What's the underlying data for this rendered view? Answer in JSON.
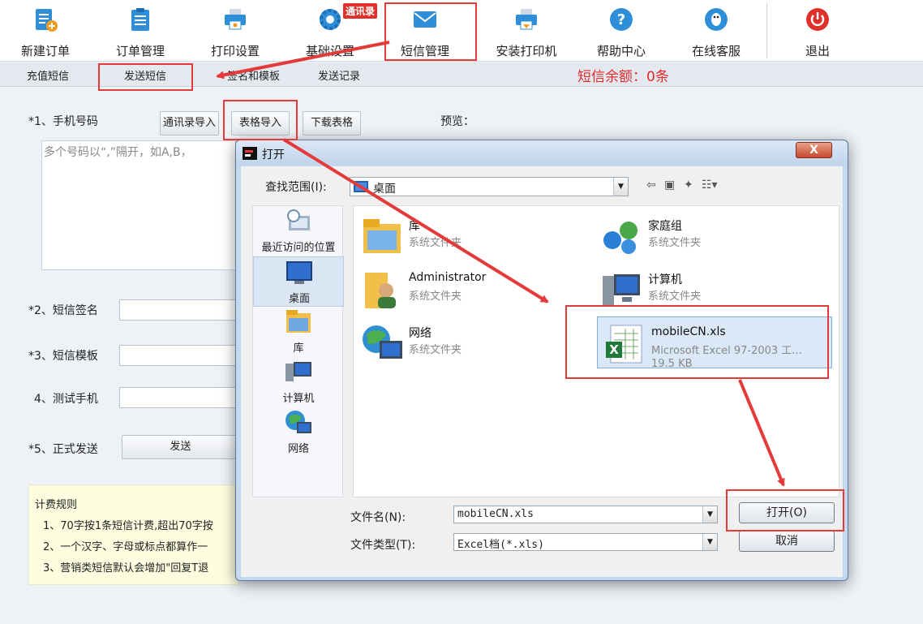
{
  "toolbar": {
    "items": [
      {
        "label": "新建订单",
        "icon": "new-order-icon"
      },
      {
        "label": "订单管理",
        "icon": "clipboard-icon"
      },
      {
        "label": "打印设置",
        "icon": "printer-settings-icon"
      },
      {
        "label": "基础设置",
        "icon": "gear-icon"
      },
      {
        "label": "短信管理",
        "icon": "envelope-icon"
      },
      {
        "label": "安装打印机",
        "icon": "install-printer-icon"
      },
      {
        "label": "帮助中心",
        "icon": "help-icon"
      },
      {
        "label": "在线客服",
        "icon": "customer-service-icon"
      },
      {
        "label": "退出",
        "icon": "power-icon"
      }
    ],
    "badge": "通讯录"
  },
  "tabs": [
    "充值短信",
    "发送短信",
    "签名和模板",
    "发送记录"
  ],
  "balance": "短信余额：0条",
  "form": {
    "phone_label": "*1、手机号码",
    "btn_contacts": "通讯录导入",
    "btn_table": "表格导入",
    "btn_download": "下载表格",
    "preview_label": "预览：",
    "phone_placeholder": "多个号码以“,”隔开，如A,B，",
    "signature_label": "*2、短信签名",
    "template_label": "*3、短信模板",
    "test_label": "4、测试手机",
    "send_label": "*5、正式发送",
    "send_button": "发送"
  },
  "rules": {
    "title": "计费规则",
    "lines": [
      "1、70字按1条短信计费,超出70字按",
      "2、一个汉字、字母或标点都算作一",
      "3、营销类短信默认会增加\"回复T退"
    ]
  },
  "dialog": {
    "title": "打开",
    "close": "X",
    "look_in_label": "查找范围(I):",
    "look_in_value": "桌面",
    "places": [
      {
        "label": "最近访问的位置",
        "icon": "recent-places-icon"
      },
      {
        "label": "桌面",
        "icon": "desktop-icon"
      },
      {
        "label": "库",
        "icon": "library-icon"
      },
      {
        "label": "计算机",
        "icon": "computer-icon"
      },
      {
        "label": "网络",
        "icon": "network-icon"
      }
    ],
    "files": [
      {
        "name": "库",
        "desc": "系统文件夹",
        "icon": "library-folder-icon"
      },
      {
        "name": "家庭组",
        "desc": "系统文件夹",
        "icon": "homegroup-icon"
      },
      {
        "name": "Administrator",
        "desc": "系统文件夹",
        "icon": "user-folder-icon"
      },
      {
        "name": "计算机",
        "desc": "系统文件夹",
        "icon": "computer-icon"
      },
      {
        "name": "网络",
        "desc": "系统文件夹",
        "icon": "network-icon"
      },
      {
        "name": "mobileCN.xls",
        "desc": "Microsoft Excel 97-2003 工...",
        "size": "19.5 KB",
        "icon": "excel-file-icon"
      }
    ],
    "filename_label": "文件名(N):",
    "filename_value": "mobileCN.xls",
    "filetype_label": "文件类型(T):",
    "filetype_value": "Excel档(*.xls)",
    "open_button": "打开(O)",
    "cancel_button": "取消"
  },
  "colors": {
    "accent_red": "#e53a3a",
    "balance_red": "#e02a2a",
    "rules_bg": "#fdfde0"
  }
}
